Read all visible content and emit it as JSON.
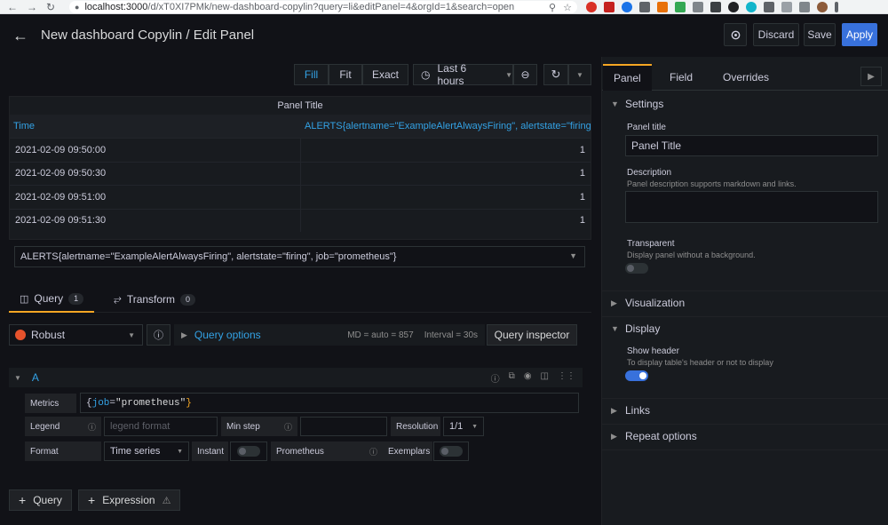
{
  "browser": {
    "url_host": "localhost:3000",
    "url_path": "/d/xT0XI7PMk/new-dashboard-copylin?query=li&editPanel=4&orgId=1&search=open"
  },
  "header": {
    "title": "New dashboard Copylin / Edit Panel",
    "discard": "Discard",
    "save": "Save",
    "apply": "Apply"
  },
  "toolbar": {
    "fill": "Fill",
    "fit": "Fit",
    "exact": "Exact",
    "time_range": "Last 6 hours"
  },
  "table_panel": {
    "title": "Panel Title",
    "columns": [
      "Time",
      "ALERTS{alertname=\"ExampleAlertAlwaysFiring\", alertstate=\"firing\","
    ],
    "rows": [
      {
        "time": "2021-02-09 09:50:00",
        "value": "1"
      },
      {
        "time": "2021-02-09 09:50:30",
        "value": "1"
      },
      {
        "time": "2021-02-09 09:51:00",
        "value": "1"
      },
      {
        "time": "2021-02-09 09:51:30",
        "value": "1"
      }
    ],
    "series_select": "ALERTS{alertname=\"ExampleAlertAlwaysFiring\", alertstate=\"firing\", job=\"prometheus\"}"
  },
  "query_tabs": {
    "query_label": "Query",
    "query_count": "1",
    "transform_label": "Transform",
    "transform_count": "0"
  },
  "query_editor": {
    "datasource": "Robust",
    "query_options": "Query options",
    "md": "MD = auto = 857",
    "interval": "Interval = 30s",
    "inspector": "Query inspector",
    "ref_id": "A",
    "metrics_label": "Metrics",
    "metrics_key": "job",
    "metrics_value": "\"prometheus\"",
    "legend_label": "Legend",
    "legend_placeholder": "legend format",
    "minstep_label": "Min step",
    "resolution_label": "Resolution",
    "resolution_value": "1/1",
    "format_label": "Format",
    "format_value": "Time series",
    "instant_label": "Instant",
    "prometheus_label": "Prometheus",
    "exemplars_label": "Exemplars",
    "add_query": "Query",
    "add_expression": "Expression"
  },
  "sidebar": {
    "tabs": [
      "Panel",
      "Field",
      "Overrides"
    ],
    "settings": "Settings",
    "panel_title_label": "Panel title",
    "panel_title_value": "Panel Title",
    "description_label": "Description",
    "description_hint": "Panel description supports markdown and links.",
    "transparent_label": "Transparent",
    "transparent_hint": "Display panel without a background.",
    "visualization": "Visualization",
    "display": "Display",
    "show_header_label": "Show header",
    "show_header_hint": "To display table's header or not to display",
    "links": "Links",
    "repeat_options": "Repeat options"
  },
  "colors": {
    "accent": "#3871dc",
    "link": "#33a2e5",
    "tab_indicator": "#f5a623",
    "background": "#111217"
  }
}
